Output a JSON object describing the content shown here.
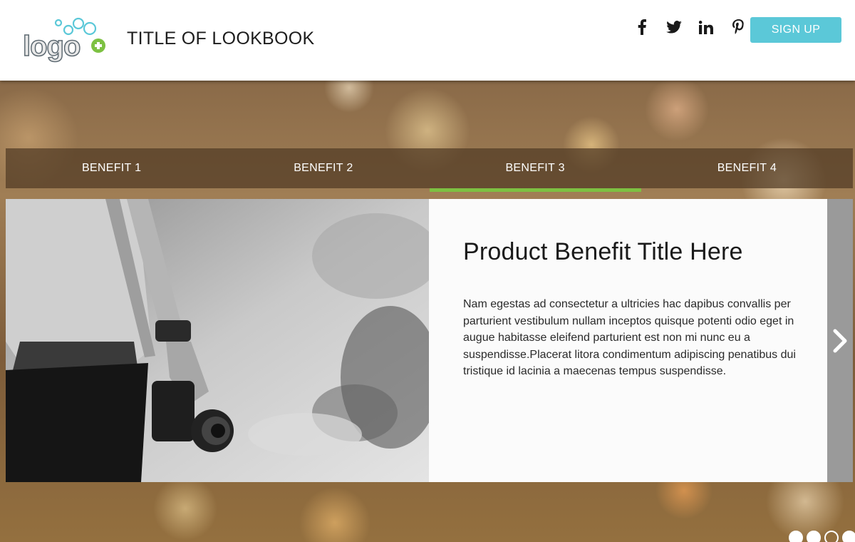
{
  "header": {
    "logo_text": "logo",
    "title": "TITLE OF LOOKBOOK",
    "social": [
      "facebook-icon",
      "twitter-icon",
      "linkedin-icon",
      "pinterest-icon"
    ],
    "signup_label": "SIGN UP"
  },
  "tabs": [
    {
      "label": "BENEFIT 1",
      "active": false
    },
    {
      "label": "BENEFIT 2",
      "active": false
    },
    {
      "label": "BENEFIT 3",
      "active": true
    },
    {
      "label": "BENEFIT 4",
      "active": false
    }
  ],
  "benefit": {
    "title": "Product Benefit Title Here",
    "text": "Nam egestas ad consectetur a ultricies hac dapibus convallis per parturient vestibulum nullam inceptos quisque potenti odio eget in augue habitasse eleifend parturient est non mi nunc eu a suspendisse.Placerat litora condimentum adipiscing penatibus dui tristique id lacinia a maecenas tempus suspendisse."
  },
  "pager": {
    "count": 4,
    "current": 3
  },
  "colors": {
    "accent": "#5bc8d8",
    "active_tab_underline": "#7dc142",
    "tab_bar": "#503a24",
    "next_arrow_bg": "#9a9a9a"
  }
}
